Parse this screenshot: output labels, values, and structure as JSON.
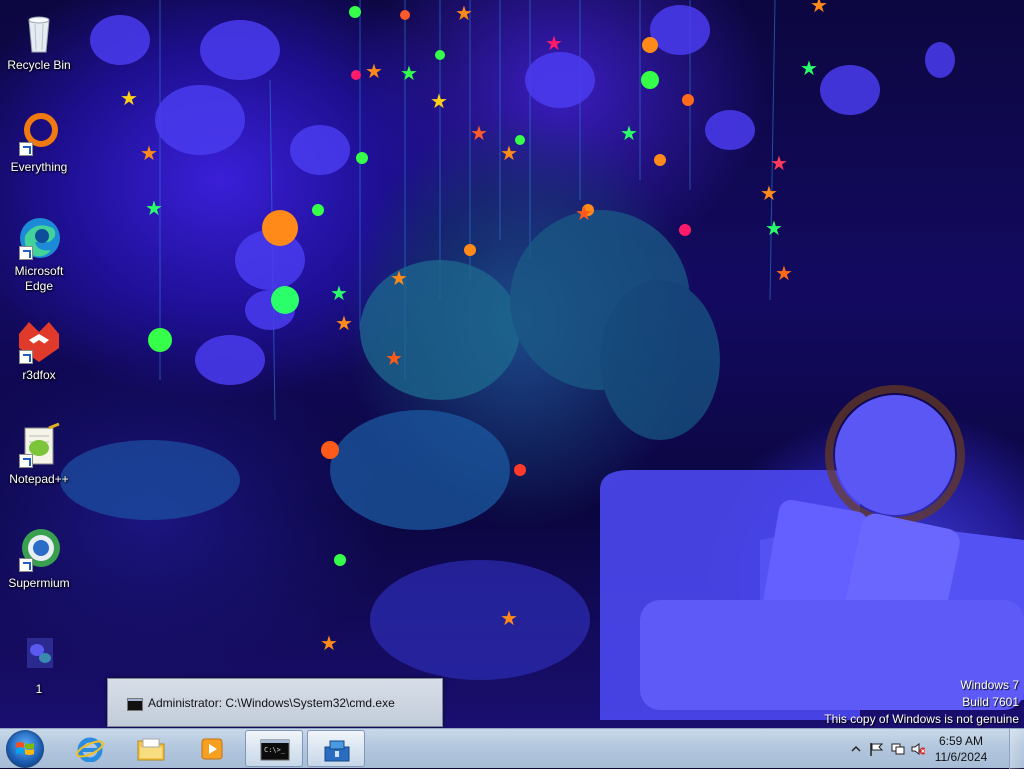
{
  "desktop": {
    "icons": [
      {
        "label": "Recycle Bin",
        "icon": "recycle-bin-icon"
      },
      {
        "label": "Everything",
        "icon": "everything-search-icon"
      },
      {
        "label": "Microsoft Edge",
        "icon": "edge-icon"
      },
      {
        "label": "r3dfox",
        "icon": "r3dfox-icon"
      },
      {
        "label": "Notepad++",
        "icon": "notepad-plus-plus-icon"
      },
      {
        "label": "Supermium",
        "icon": "supermium-icon"
      },
      {
        "label": "1",
        "icon": "image-file-icon"
      }
    ],
    "watermark": {
      "line1": "Windows 7",
      "line2": "Build 7601",
      "line3": "This copy of Windows is not genuine"
    }
  },
  "thumbnail_popup": {
    "title": "Administrator: C:\\Windows\\System32\\cmd.exe",
    "icon": "cmd-icon"
  },
  "taskbar": {
    "start": "start-orb-icon",
    "pinned": [
      {
        "name": "internet-explorer",
        "icon": "internet-explorer-icon"
      },
      {
        "name": "windows-explorer",
        "icon": "folder-icon"
      },
      {
        "name": "windows-media-player",
        "icon": "media-player-icon"
      },
      {
        "name": "cmd",
        "icon": "cmd-icon",
        "active": true
      },
      {
        "name": "app",
        "icon": "package-icon",
        "active": true
      }
    ],
    "tray": {
      "icons": [
        "show-hidden-icons-chevron",
        "action-center-flag-icon",
        "network-icon",
        "volume-muted-icon"
      ],
      "time": "6:59 AM",
      "date": "11/6/2024"
    }
  },
  "colors": {
    "taskbar": "#b3c7de",
    "accent": "#1c5fb3"
  }
}
